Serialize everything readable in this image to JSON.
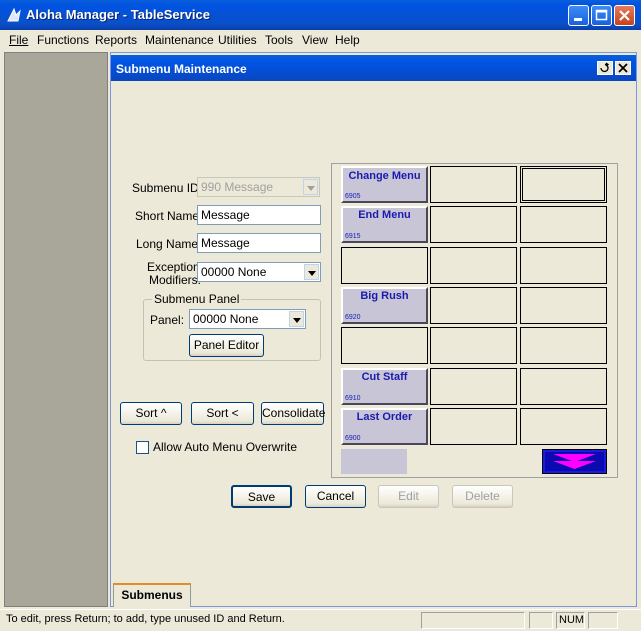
{
  "window": {
    "title": "Aloha Manager - TableService"
  },
  "menu": [
    "File",
    "Functions",
    "Reports",
    "Maintenance",
    "Utilities",
    "Tools",
    "View",
    "Help"
  ],
  "child": {
    "title": "Submenu Maintenance"
  },
  "form": {
    "submenu_id_label": "Submenu ID:",
    "submenu_id_value": "990 Message",
    "short_name_label": "Short Name:",
    "short_name_value": "Message",
    "long_name_label": "Long Name:",
    "long_name_value": "Message",
    "exception_label_1": "Exception",
    "exception_label_2": "Modifiers:",
    "exception_value": "00000 None",
    "panel_group_label": "Submenu Panel",
    "panel_label": "Panel:",
    "panel_value": "00000 None",
    "panel_editor_button": "Panel Editor",
    "sort_up_button": "Sort ^",
    "sort_left_button": "Sort <",
    "consolidate_button": "Consolidate",
    "allow_auto_label": "Allow Auto Menu Overwrite"
  },
  "grid": {
    "buttons": [
      {
        "label": "Change Menu",
        "id": "6905"
      },
      {
        "label": "End Menu",
        "id": "6915"
      },
      {
        "label": "Big Rush",
        "id": "6920"
      },
      {
        "label": "Cut Staff",
        "id": "6910"
      },
      {
        "label": "Last Order",
        "id": "6900"
      }
    ]
  },
  "actions": {
    "save": "Save",
    "cancel": "Cancel",
    "edit": "Edit",
    "delete": "Delete"
  },
  "tab": "Submenus",
  "status": {
    "text": "To edit, press Return; to add, type unused ID and Return.",
    "num": "NUM"
  },
  "colors": {
    "titlebar": "#0054e3",
    "grid_text": "#1a1ab0",
    "grid_button": "#c8c6d6",
    "nav_arrow": "#ff00ff",
    "nav_bg": "#1a1ae0"
  },
  "icons": [
    "app-icon",
    "minimize-icon",
    "maximize-icon",
    "close-icon",
    "restore-icon",
    "chevron-down-icon",
    "double-down-arrow-icon"
  ]
}
